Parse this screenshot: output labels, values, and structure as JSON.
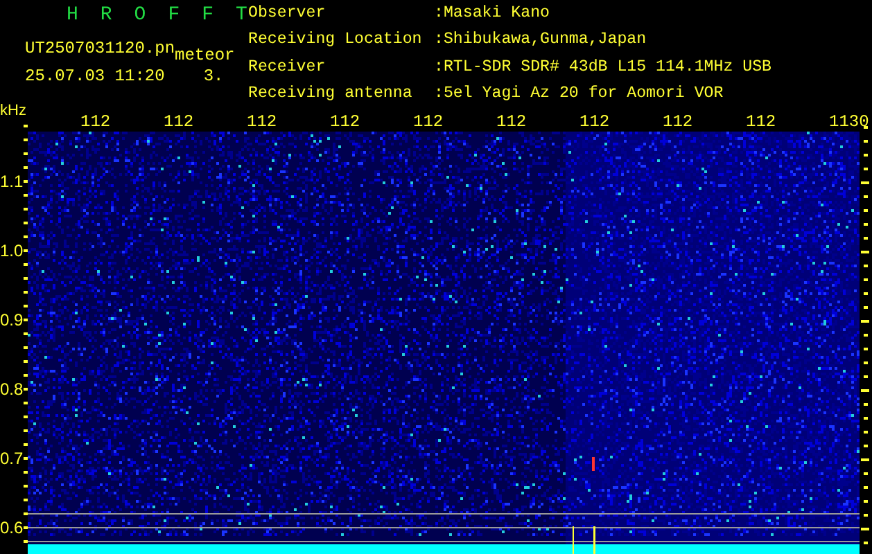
{
  "header": {
    "program": "H R O F F T",
    "file_name": "UT2507031120.pn",
    "mode": "meteor",
    "date_time": "25.07.03 11:20",
    "count": "3.",
    "info": [
      {
        "label": "Observer",
        "value": ":Masaki Kano"
      },
      {
        "label": "Receiving Location",
        "value": ":Shibukawa,Gunma,Japan"
      },
      {
        "label": "Receiver",
        "value": ":RTL-SDR SDR# 43dB L15 114.1MHz USB"
      },
      {
        "label": "Receiving antenna",
        "value": ":5el Yagi Az 20 for Aomori VOR"
      }
    ]
  },
  "spectrogram": {
    "y_unit": "kHz",
    "x_labels": [
      "112",
      "112",
      "112",
      "112",
      "112",
      "112",
      "112",
      "112",
      "112",
      "1130"
    ],
    "y_labels": [
      "1.1",
      "1.0",
      "0.9",
      "0.8",
      "0.7",
      "0.6"
    ]
  }
}
